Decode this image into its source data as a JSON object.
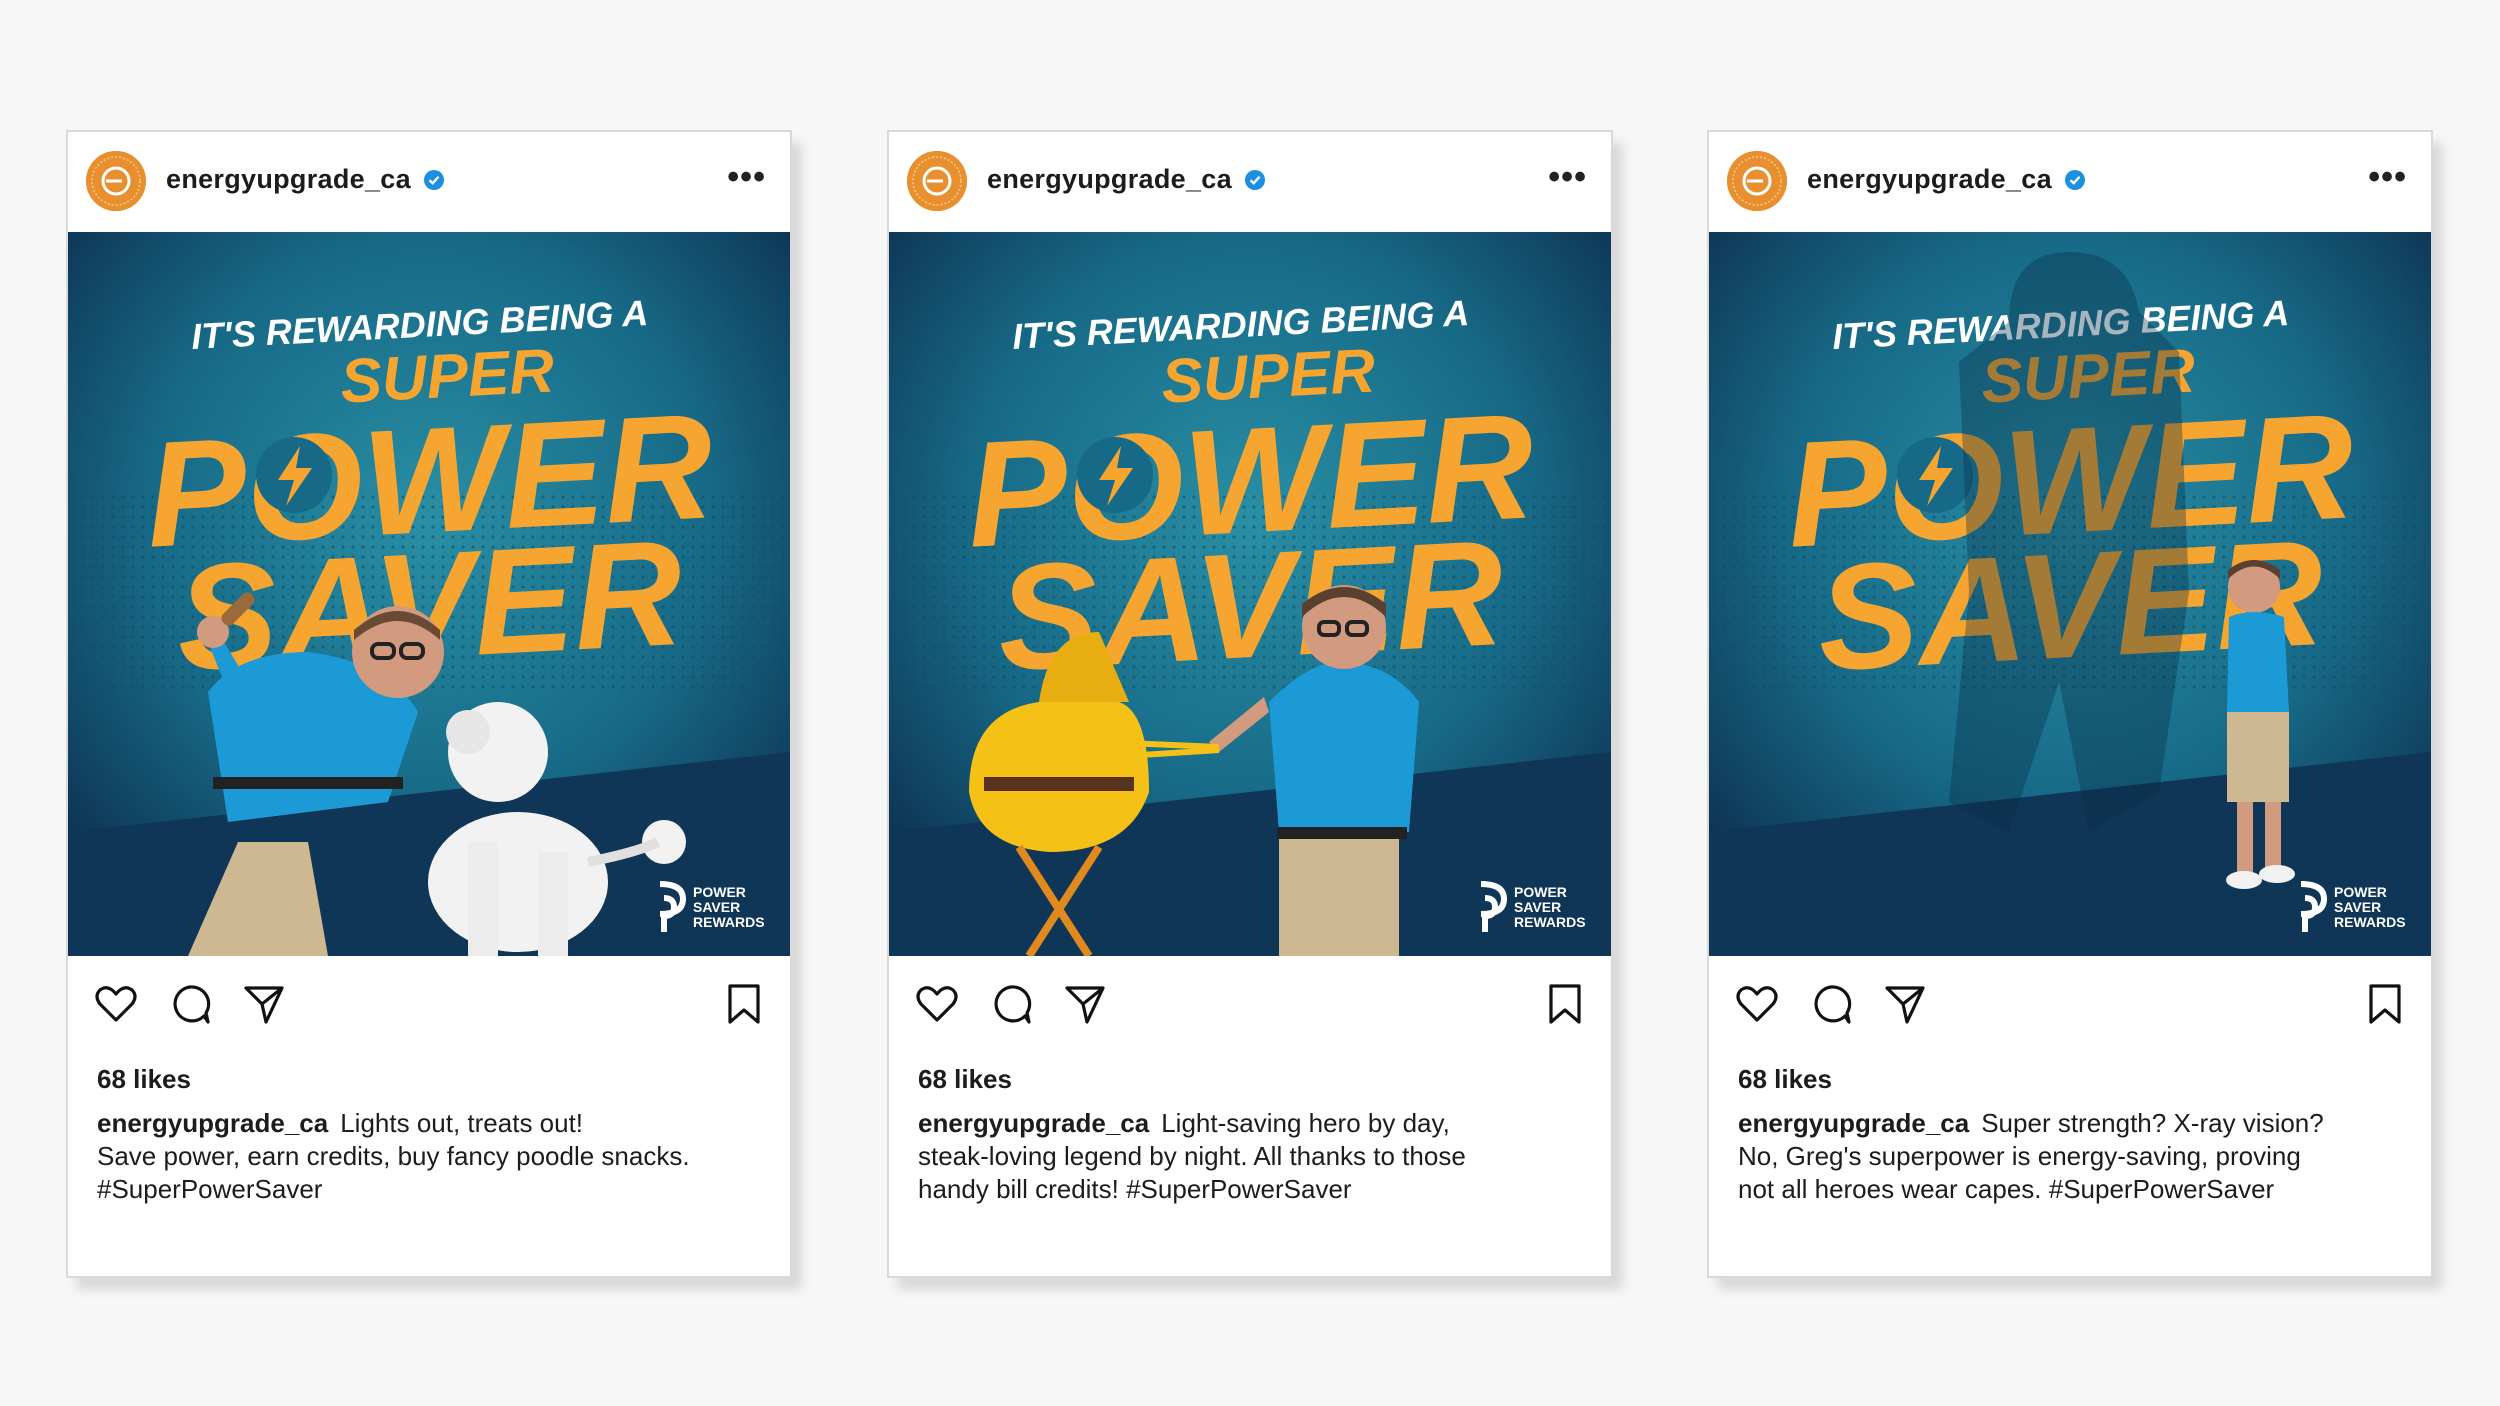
{
  "colors": {
    "accent_orange": "#f7a531",
    "bg_teal": "#176a87",
    "bg_navy": "#0d2c4d",
    "shirt_blue": "#1c9ad6",
    "verified_blue": "#1d8fe1"
  },
  "posts": [
    {
      "username": "energyupgrade_ca",
      "more_label": "•••",
      "ad": {
        "tagline": "IT'S REWARDING BEING A",
        "word1": "SUPER",
        "word2": "POWER",
        "word3": "SAVER",
        "brand_line1": "POWER",
        "brand_line2": "SAVER",
        "brand_line3": "REWARDS",
        "scene": "man-with-poodle"
      },
      "likes": "68 likes",
      "caption_user": "energyupgrade_ca",
      "caption_lines": [
        "Lights out, treats out!",
        "Save power, earn credits, buy fancy poodle snacks.",
        "#SuperPowerSaver"
      ],
      "icons": [
        "heart-icon",
        "comment-icon",
        "share-icon",
        "bookmark-icon"
      ]
    },
    {
      "username": "energyupgrade_ca",
      "more_label": "•••",
      "ad": {
        "tagline": "IT'S REWARDING BEING A",
        "word1": "SUPER",
        "word2": "POWER",
        "word3": "SAVER",
        "brand_line1": "POWER",
        "brand_line2": "SAVER",
        "brand_line3": "REWARDS",
        "scene": "man-with-grill"
      },
      "likes": "68 likes",
      "caption_user": "energyupgrade_ca",
      "caption_lines": [
        "Light-saving hero by day,",
        "steak-loving legend by night. All thanks to those",
        "handy bill credits! #SuperPowerSaver"
      ],
      "icons": [
        "heart-icon",
        "comment-icon",
        "share-icon",
        "bookmark-icon"
      ]
    },
    {
      "username": "energyupgrade_ca",
      "more_label": "•••",
      "ad": {
        "tagline": "IT'S REWARDING BEING A",
        "word1": "SUPER",
        "word2": "POWER",
        "word3": "SAVER",
        "brand_line1": "POWER",
        "brand_line2": "SAVER",
        "brand_line3": "REWARDS",
        "scene": "man-with-shadow"
      },
      "likes": "68 likes",
      "caption_user": "energyupgrade_ca",
      "caption_lines": [
        "Super strength? X-ray vision?",
        "No, Greg's superpower is energy-saving, proving",
        "not all heroes wear capes. #SuperPowerSaver"
      ],
      "icons": [
        "heart-icon",
        "comment-icon",
        "share-icon",
        "bookmark-icon"
      ]
    }
  ]
}
